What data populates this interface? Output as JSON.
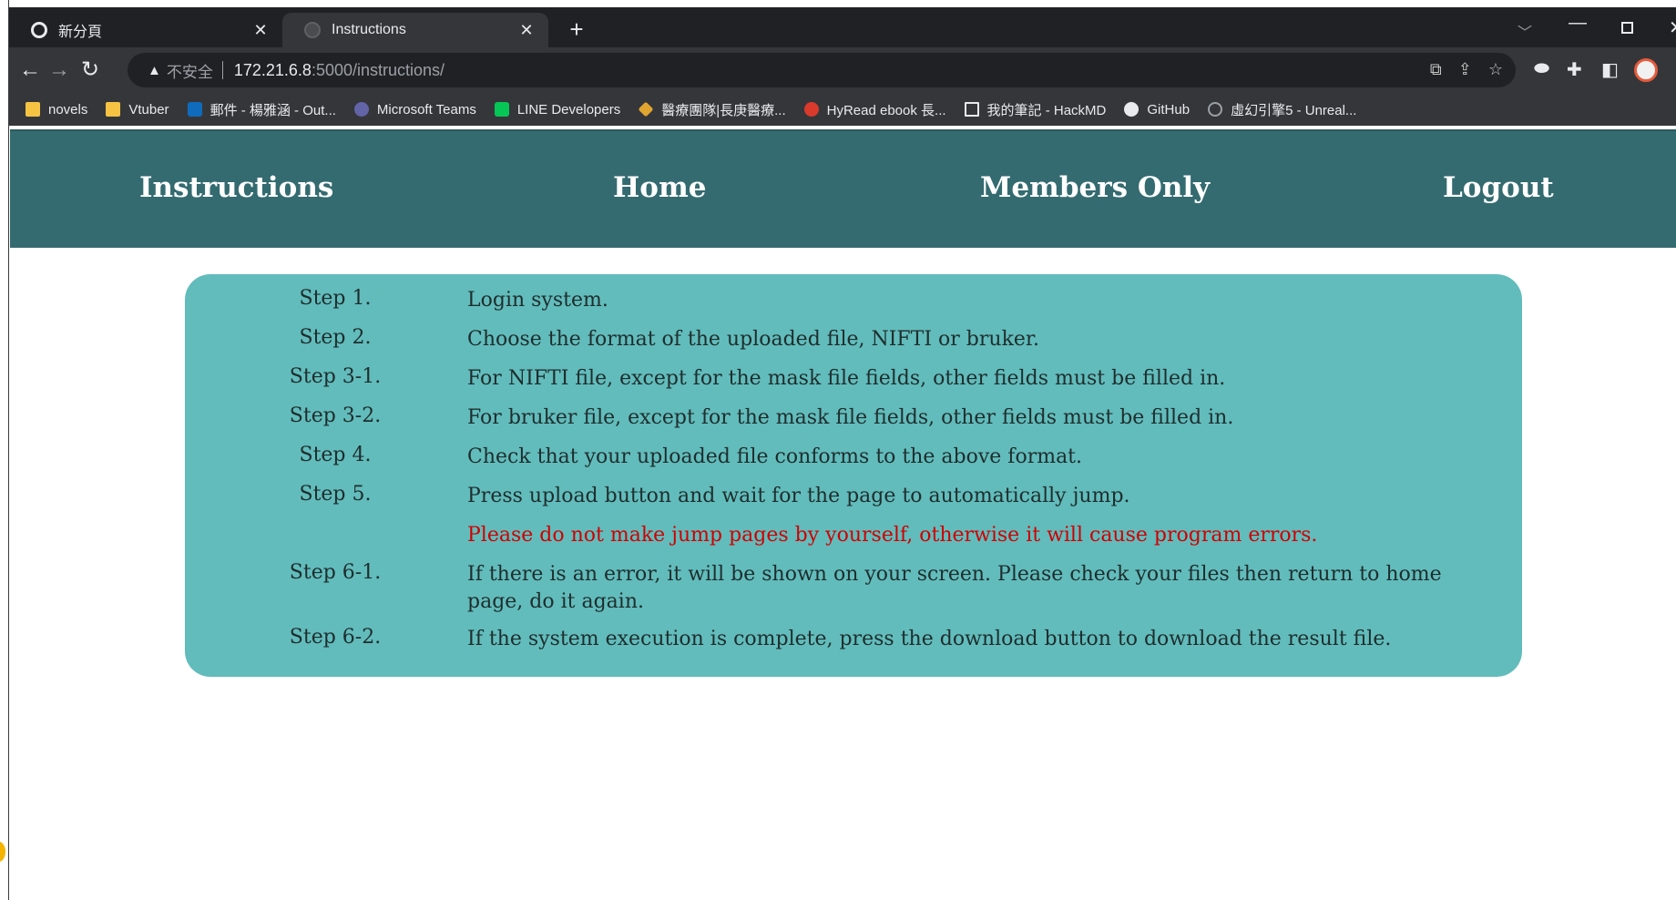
{
  "browser": {
    "tabs": [
      {
        "title": "新分頁",
        "icon": "chrome-icon",
        "active": false
      },
      {
        "title": "Instructions",
        "icon": "globe-icon",
        "active": true
      }
    ],
    "new_tab_label": "+",
    "address": {
      "security_label": "不安全",
      "host": "172.21.6.8",
      "path": ":5000/instructions/"
    },
    "bookmarks": [
      {
        "label": "novels",
        "icon": "folder-icon"
      },
      {
        "label": "Vtuber",
        "icon": "folder-icon"
      },
      {
        "label": "郵件 - 楊雅涵 - Out...",
        "icon": "outlook-icon"
      },
      {
        "label": "Microsoft Teams",
        "icon": "teams-icon"
      },
      {
        "label": "LINE Developers",
        "icon": "line-icon"
      },
      {
        "label": "醫療團隊|長庚醫療...",
        "icon": "medical-icon"
      },
      {
        "label": "HyRead ebook 長...",
        "icon": "hyread-icon"
      },
      {
        "label": "我的筆記 - HackMD",
        "icon": "document-icon"
      },
      {
        "label": "GitHub",
        "icon": "github-icon"
      },
      {
        "label": "虛幻引擎5 - Unreal...",
        "icon": "unreal-icon"
      }
    ]
  },
  "site": {
    "nav": {
      "instructions": "Instructions",
      "home": "Home",
      "members_only": "Members Only",
      "logout": "Logout"
    },
    "steps": [
      {
        "label": "Step 1.",
        "text": "Login system."
      },
      {
        "label": "Step 2.",
        "text": "Choose the format of the uploaded file, NIFTI or bruker."
      },
      {
        "label": "Step 3-1.",
        "text": "For NIFTI file, except for the mask file fields, other fields must be filled in."
      },
      {
        "label": "Step 3-2.",
        "text": "For bruker file, except for the mask file fields, other fields must be filled in."
      },
      {
        "label": "Step 4.",
        "text": "Check that your uploaded file conforms to the above format."
      },
      {
        "label": "Step 5.",
        "text": "Press upload button and wait for the page to automatically jump."
      },
      {
        "label": "",
        "text": "Please do not make jump pages by yourself, otherwise it will cause program errors."
      },
      {
        "label": "Step 6-1.",
        "text": "If there is an error, it will be shown on your screen. Please check your files then return to home page, do it again."
      },
      {
        "label": "Step 6-2.",
        "text": "If the system execution is complete, press the download button to download the result file."
      }
    ],
    "colors": {
      "nav_bg": "#346b70",
      "panel_bg": "#62bcbc",
      "warning_text": "#d00000"
    }
  }
}
